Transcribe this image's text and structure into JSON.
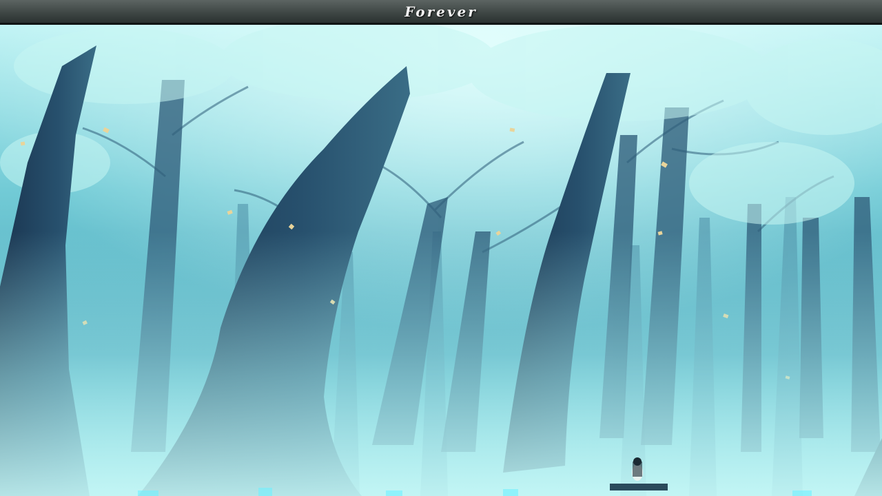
{
  "title": "Forever",
  "colors": {
    "mist": "#9fe6ea",
    "canopy": "#7fd6dc",
    "trunk_dark": "#1c3a52",
    "trunk_mid": "#2c5573",
    "leaf": "#e9d49a"
  }
}
